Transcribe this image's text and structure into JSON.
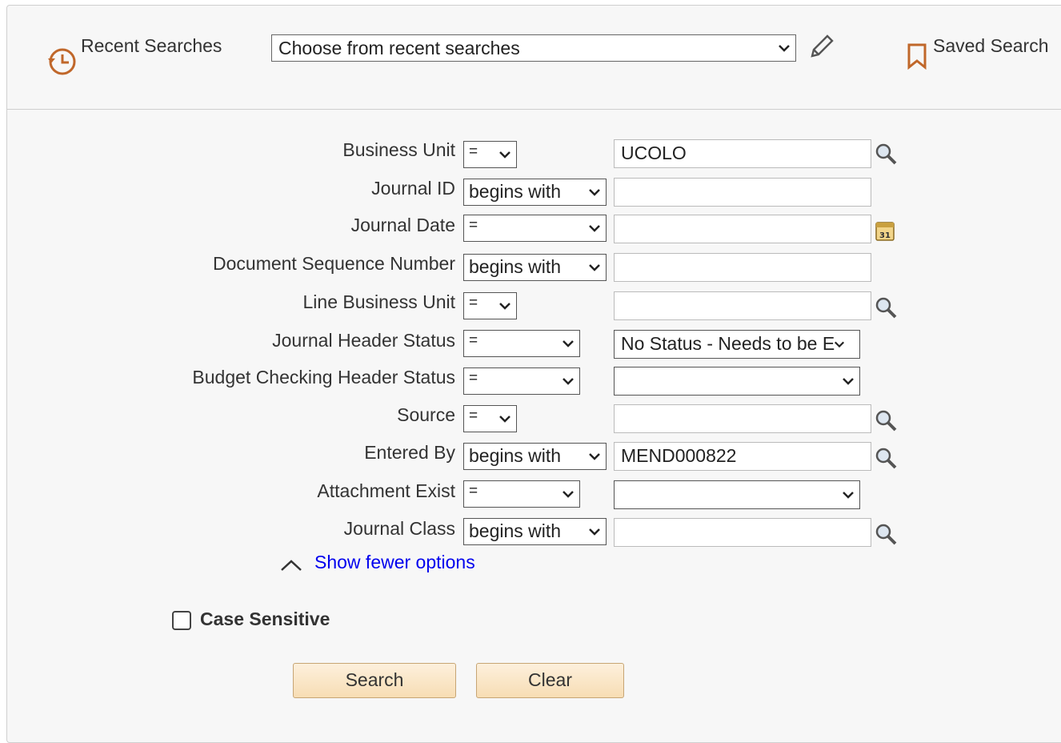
{
  "top": {
    "recent_label": "Recent Searches",
    "recent_select_value": "Choose from recent searches",
    "saved_label": "Saved Search"
  },
  "fields": {
    "business_unit": {
      "label": "Business Unit",
      "op": "=",
      "value": "UCOLO"
    },
    "journal_id": {
      "label": "Journal ID",
      "op": "begins with",
      "value": ""
    },
    "journal_date": {
      "label": "Journal Date",
      "op": "=",
      "value": "",
      "calendar_text": "31"
    },
    "doc_seq": {
      "label": "Document Sequence Number",
      "op": "begins with",
      "value": ""
    },
    "line_bu": {
      "label": "Line Business Unit",
      "op": "=",
      "value": ""
    },
    "jh_status": {
      "label": "Journal Header Status",
      "op": "=",
      "value": "No Status - Needs to be E"
    },
    "bc_status": {
      "label": "Budget Checking Header Status",
      "op": "=",
      "value": ""
    },
    "source": {
      "label": "Source",
      "op": "=",
      "value": ""
    },
    "entered_by": {
      "label": "Entered By",
      "op": "begins with",
      "value": "MEND000822"
    },
    "attachment": {
      "label": "Attachment Exist",
      "op": "=",
      "value": ""
    },
    "journal_class": {
      "label": "Journal Class",
      "op": "begins with",
      "value": ""
    }
  },
  "options": {
    "show_fewer": "Show fewer options",
    "case_sensitive": "Case Sensitive",
    "case_sensitive_checked": false
  },
  "buttons": {
    "search": "Search",
    "clear": "Clear"
  },
  "colors": {
    "accent_icon": "#c0672a",
    "link": "#0000ee",
    "button_top": "#fdf0dc",
    "button_bottom": "#f7ddb4"
  },
  "icons": {
    "recent": "history-icon",
    "edit": "pencil-icon",
    "saved": "bookmark-icon",
    "lookup": "magnifier-icon",
    "calendar": "calendar-icon"
  }
}
